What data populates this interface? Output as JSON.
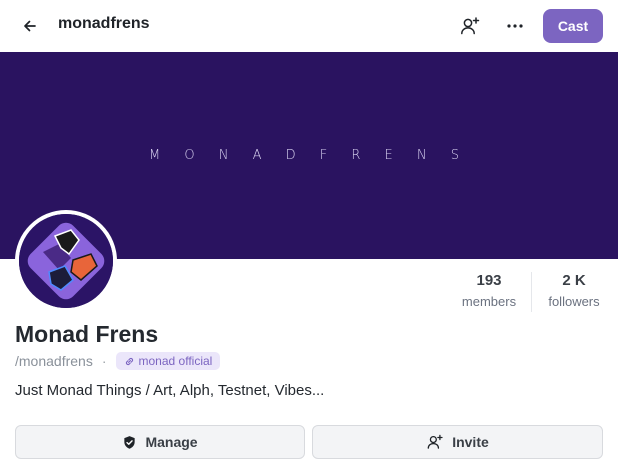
{
  "header": {
    "title": "monadfrens",
    "cast_label": "Cast",
    "back_icon": "arrow-left-icon",
    "add_member_icon": "user-plus-icon",
    "more_icon": "more-horizontal-icon",
    "accent_color": "#7c65c1"
  },
  "banner": {
    "text": "M O N A D   F R E N S",
    "background": "#2a1360"
  },
  "channel": {
    "name": "Monad Frens",
    "handle": "/monadfrens",
    "separator": "·",
    "badge_label": "monad official",
    "badge_icon": "link-icon",
    "description": "Just Monad Things / Art, Alph, Testnet, Vibes..."
  },
  "stats": {
    "members_count": "193",
    "members_label": "members",
    "followers_count": "2 K",
    "followers_label": "followers"
  },
  "actions": {
    "manage_label": "Manage",
    "manage_icon": "shield-check-icon",
    "invite_label": "Invite",
    "invite_icon": "user-plus-icon"
  }
}
